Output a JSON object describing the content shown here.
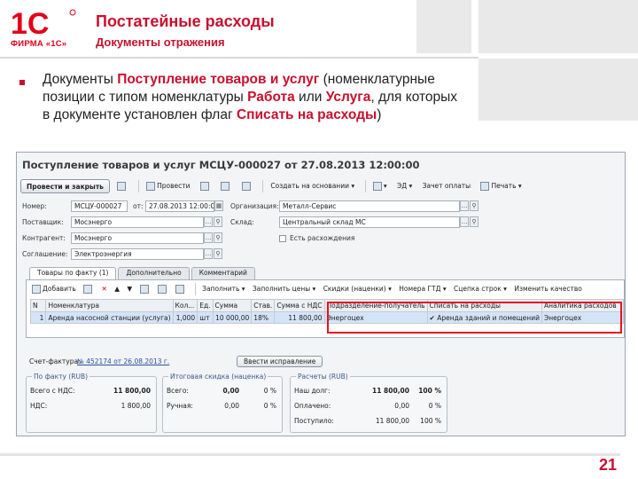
{
  "slide": {
    "logo_text": "1С",
    "logo_caption": "ФИРМА «1С»",
    "title": "Постатейные расходы",
    "subtitle": "Документы отражения",
    "body": {
      "t1": "Документы ",
      "h1": "Поступление товаров и услуг",
      "t2": " (номенклатурные позиции с типом номенклатуры ",
      "h2": "Работа",
      "t3": " или ",
      "h3": "Услуга",
      "t4": ", для которых в документе установлен флаг ",
      "h4": "Списать на расходы",
      "t5": ")"
    },
    "page_number": "21",
    "colors": {
      "accent": "#c8102e",
      "highlight_box": "#e8131f",
      "selected_row": "#d4e4f7"
    }
  },
  "window": {
    "title": "Поступление товаров и услуг МСЦУ-000027 от 27.08.2013 12:00:00",
    "toolbar": {
      "post_close": "Провести и закрыть",
      "post": "Провести",
      "create_based": "Создать на основании",
      "ed": "ЭД",
      "invoice": "Зачет оплаты",
      "print": "Печать"
    },
    "header": {
      "number_label": "Номер:",
      "number_value": "МСЦУ-000027",
      "date_label": "от:",
      "date_value": "27.08.2013 12:00:00",
      "org_label": "Организация:",
      "org_value": "Металл-Сервис",
      "supplier_label": "Поставщик:",
      "supplier_value": "Мосэнерго",
      "warehouse_label": "Склад:",
      "warehouse_value": "Центральный склад МС",
      "counterparty_label": "Контрагент:",
      "counterparty_value": "Мосэнерго",
      "discrepancy_label": "Есть расхождения",
      "agreement_label": "Соглашение:",
      "agreement_value": "Электроэнергия"
    },
    "tabs": [
      "Товары по факту (1)",
      "Дополнительно",
      "Комментарий"
    ],
    "table_toolbar": {
      "add": "Добавить",
      "fill": "Заполнить",
      "fill_prices": "Заполнить цены",
      "discounts": "Скидки (наценки)",
      "gtd": "Номера ГТД",
      "rows_link": "Сцепка строк",
      "change_quality": "Изменить качество"
    },
    "table": {
      "columns": [
        "N",
        "Номенклатура",
        "Кол...",
        "Ед.",
        "Сумма",
        "Став.",
        "Сумма с НДС",
        "Подразделение-получатель",
        "Списать на расходы",
        "Аналитика расходов"
      ],
      "rows": [
        [
          "1",
          "Аренда насосной станции (услуга)",
          "1,000",
          "шт",
          "10 000,00",
          "18%",
          "11 800,00",
          "Энергоцех",
          "✔ Аренда зданий и помещений",
          "Энергоцех"
        ]
      ]
    },
    "invoice_line": {
      "label": "Счет-фактура:",
      "link": "№ 452174 от 26.08.2013 г.",
      "button": "Ввести исправление"
    },
    "group_fact": {
      "title": "По факту (RUB)",
      "total_label": "Всего с НДС:",
      "total_value": "11 800,00",
      "vat_label": "НДС:",
      "vat_value": "1 800,00"
    },
    "group_discount": {
      "title": "Итоговая скидка (наценка)",
      "total_label": "Всего:",
      "total_value": "0,00",
      "total_pct": "0 %",
      "manual_label": "Ручная:",
      "manual_value": "0,00",
      "manual_pct": "0 %"
    },
    "group_settlements": {
      "title": "Расчеты (RUB)",
      "debt_label": "Наш долг:",
      "debt_value": "11 800,00",
      "debt_pct": "100 %",
      "paid_label": "Оплачено:",
      "paid_value": "0,00",
      "paid_pct": "0 %",
      "received_label": "Поступило:",
      "received_value": "11 800,00",
      "received_pct": "100 %"
    }
  }
}
